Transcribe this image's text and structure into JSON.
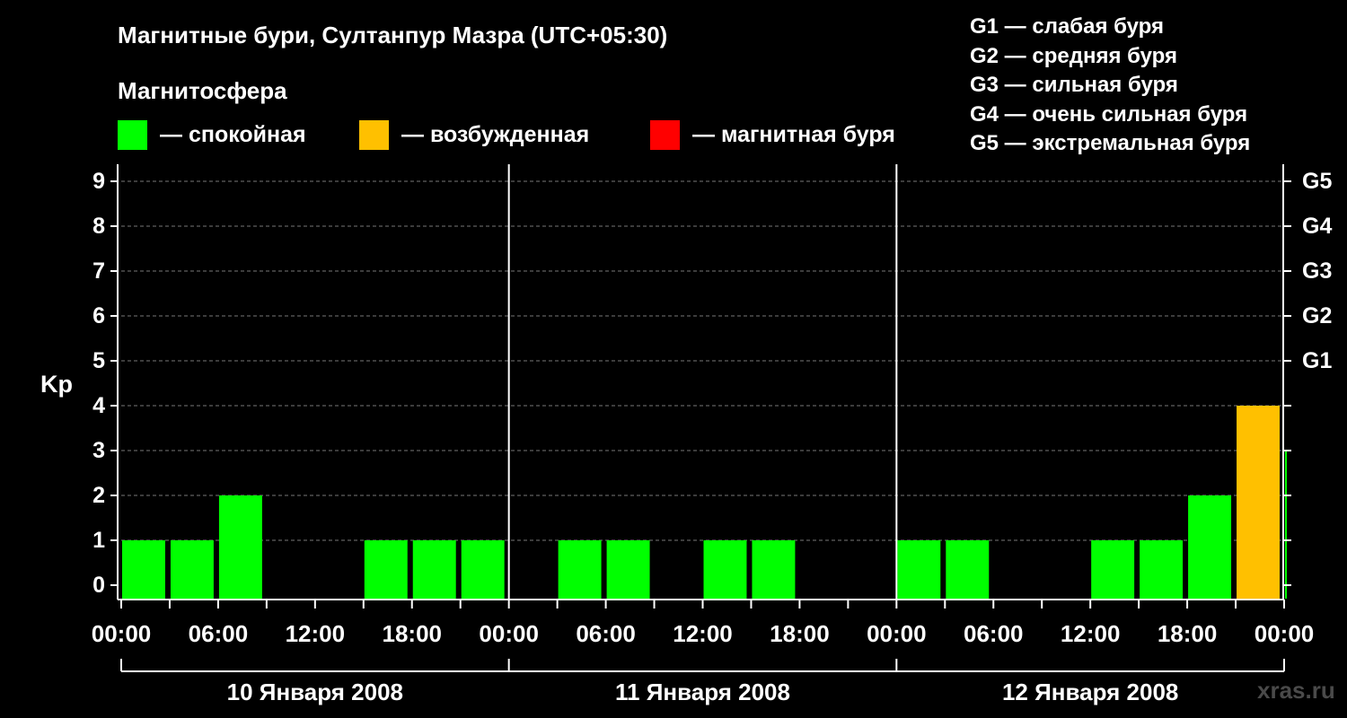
{
  "title": "Магнитные бури, Султанпур Мазра (UTC+05:30)",
  "magnetosphere_label": "Магнитосфера",
  "legend": [
    {
      "label": "— спокойная",
      "color": "#00ff00"
    },
    {
      "label": "— возбужденная",
      "color": "#ffc000"
    },
    {
      "label": "— магнитная буря",
      "color": "#ff0000"
    }
  ],
  "g_levels": [
    "G1 — слабая буря",
    "G2 — средняя буря",
    "G3 — сильная буря",
    "G4 — очень сильная буря",
    "G5 — экстремальная буря"
  ],
  "watermark": "xras.ru",
  "chart_data": {
    "type": "bar",
    "ylabel": "Kp",
    "ylim": [
      0,
      9
    ],
    "y_ticks": [
      "0",
      "1",
      "2",
      "3",
      "4",
      "5",
      "6",
      "7",
      "8",
      "9"
    ],
    "right_axis_ticks": [
      {
        "value": 5,
        "label": "G1"
      },
      {
        "value": 6,
        "label": "G2"
      },
      {
        "value": 7,
        "label": "G3"
      },
      {
        "value": 8,
        "label": "G4"
      },
      {
        "value": 9,
        "label": "G5"
      }
    ],
    "x_tick_labels": [
      "00:00",
      "06:00",
      "12:00",
      "18:00",
      "00:00",
      "06:00",
      "12:00",
      "18:00",
      "00:00",
      "06:00",
      "12:00",
      "18:00",
      "00:00"
    ],
    "days": [
      "10 Января 2008",
      "11 Января 2008",
      "12 Января 2008"
    ],
    "grid": true,
    "bin_hours": 3,
    "values": [
      1,
      1,
      2,
      0,
      0,
      1,
      1,
      1,
      0,
      1,
      1,
      0,
      1,
      1,
      0,
      0,
      1,
      1,
      0,
      0,
      1,
      1,
      2,
      4,
      3
    ],
    "colors": [
      "#00ff00",
      "#00ff00",
      "#00ff00",
      "#00ff00",
      "#00ff00",
      "#00ff00",
      "#00ff00",
      "#00ff00",
      "#00ff00",
      "#00ff00",
      "#00ff00",
      "#00ff00",
      "#00ff00",
      "#00ff00",
      "#00ff00",
      "#00ff00",
      "#00ff00",
      "#00ff00",
      "#00ff00",
      "#00ff00",
      "#00ff00",
      "#00ff00",
      "#00ff00",
      "#ffc000",
      "#00ff00"
    ]
  }
}
